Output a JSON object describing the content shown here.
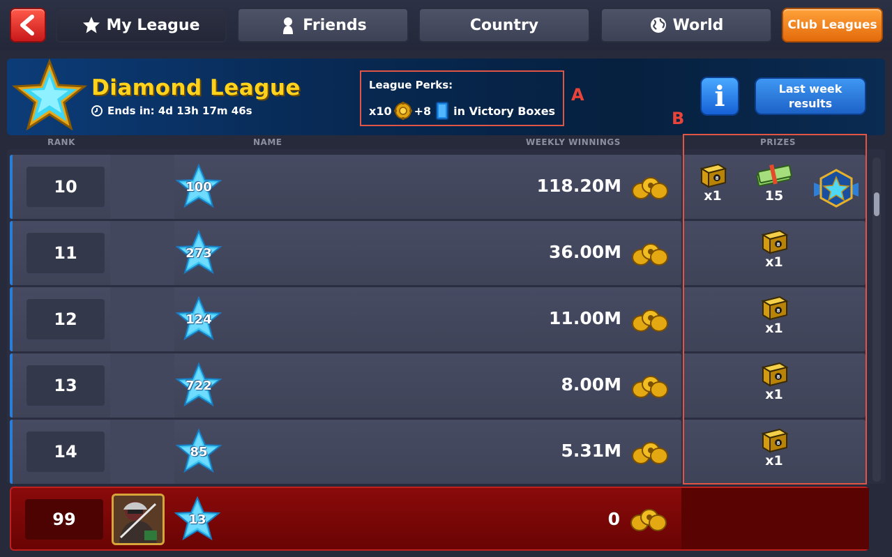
{
  "nav": {
    "my_league": "My League",
    "friends": "Friends",
    "country": "Country",
    "world": "World",
    "club_leagues": "Club Leagues"
  },
  "banner": {
    "title": "Diamond League",
    "ends_in": "Ends in: 4d 13h 17m 46s",
    "perks_title": "League Perks:",
    "perks_x": "x10",
    "perks_plus": "+8",
    "perks_suffix": "in Victory Boxes",
    "annotation_a": "A",
    "last_week": "Last week results"
  },
  "columns": {
    "rank": "RANK",
    "name": "NAME",
    "weekly_winnings": "WEEKLY WINNINGS",
    "prizes": "PRIZES",
    "annotation_b": "B"
  },
  "rows": [
    {
      "rank": "10",
      "level": "100",
      "winnings": "118.20M",
      "prizes": [
        {
          "kind": "box",
          "label": "x1"
        },
        {
          "kind": "cash",
          "label": "15"
        },
        {
          "kind": "badge",
          "label": ""
        }
      ]
    },
    {
      "rank": "11",
      "level": "273",
      "winnings": "36.00M",
      "prizes": [
        {
          "kind": "box",
          "label": "x1"
        }
      ]
    },
    {
      "rank": "12",
      "level": "124",
      "winnings": "11.00M",
      "prizes": [
        {
          "kind": "box",
          "label": "x1"
        }
      ]
    },
    {
      "rank": "13",
      "level": "722",
      "winnings": "8.00M",
      "prizes": [
        {
          "kind": "box",
          "label": "x1"
        }
      ]
    },
    {
      "rank": "14",
      "level": "85",
      "winnings": "5.31M",
      "prizes": [
        {
          "kind": "box",
          "label": "x1"
        }
      ]
    }
  ],
  "my_row": {
    "rank": "99",
    "level": "13",
    "winnings": "0"
  },
  "colors": {
    "accent_gold": "#ffd21c",
    "annotation_red": "#e05545",
    "highlight_red": "#8a0a0a",
    "row_accent_blue": "#2b7ed8"
  }
}
